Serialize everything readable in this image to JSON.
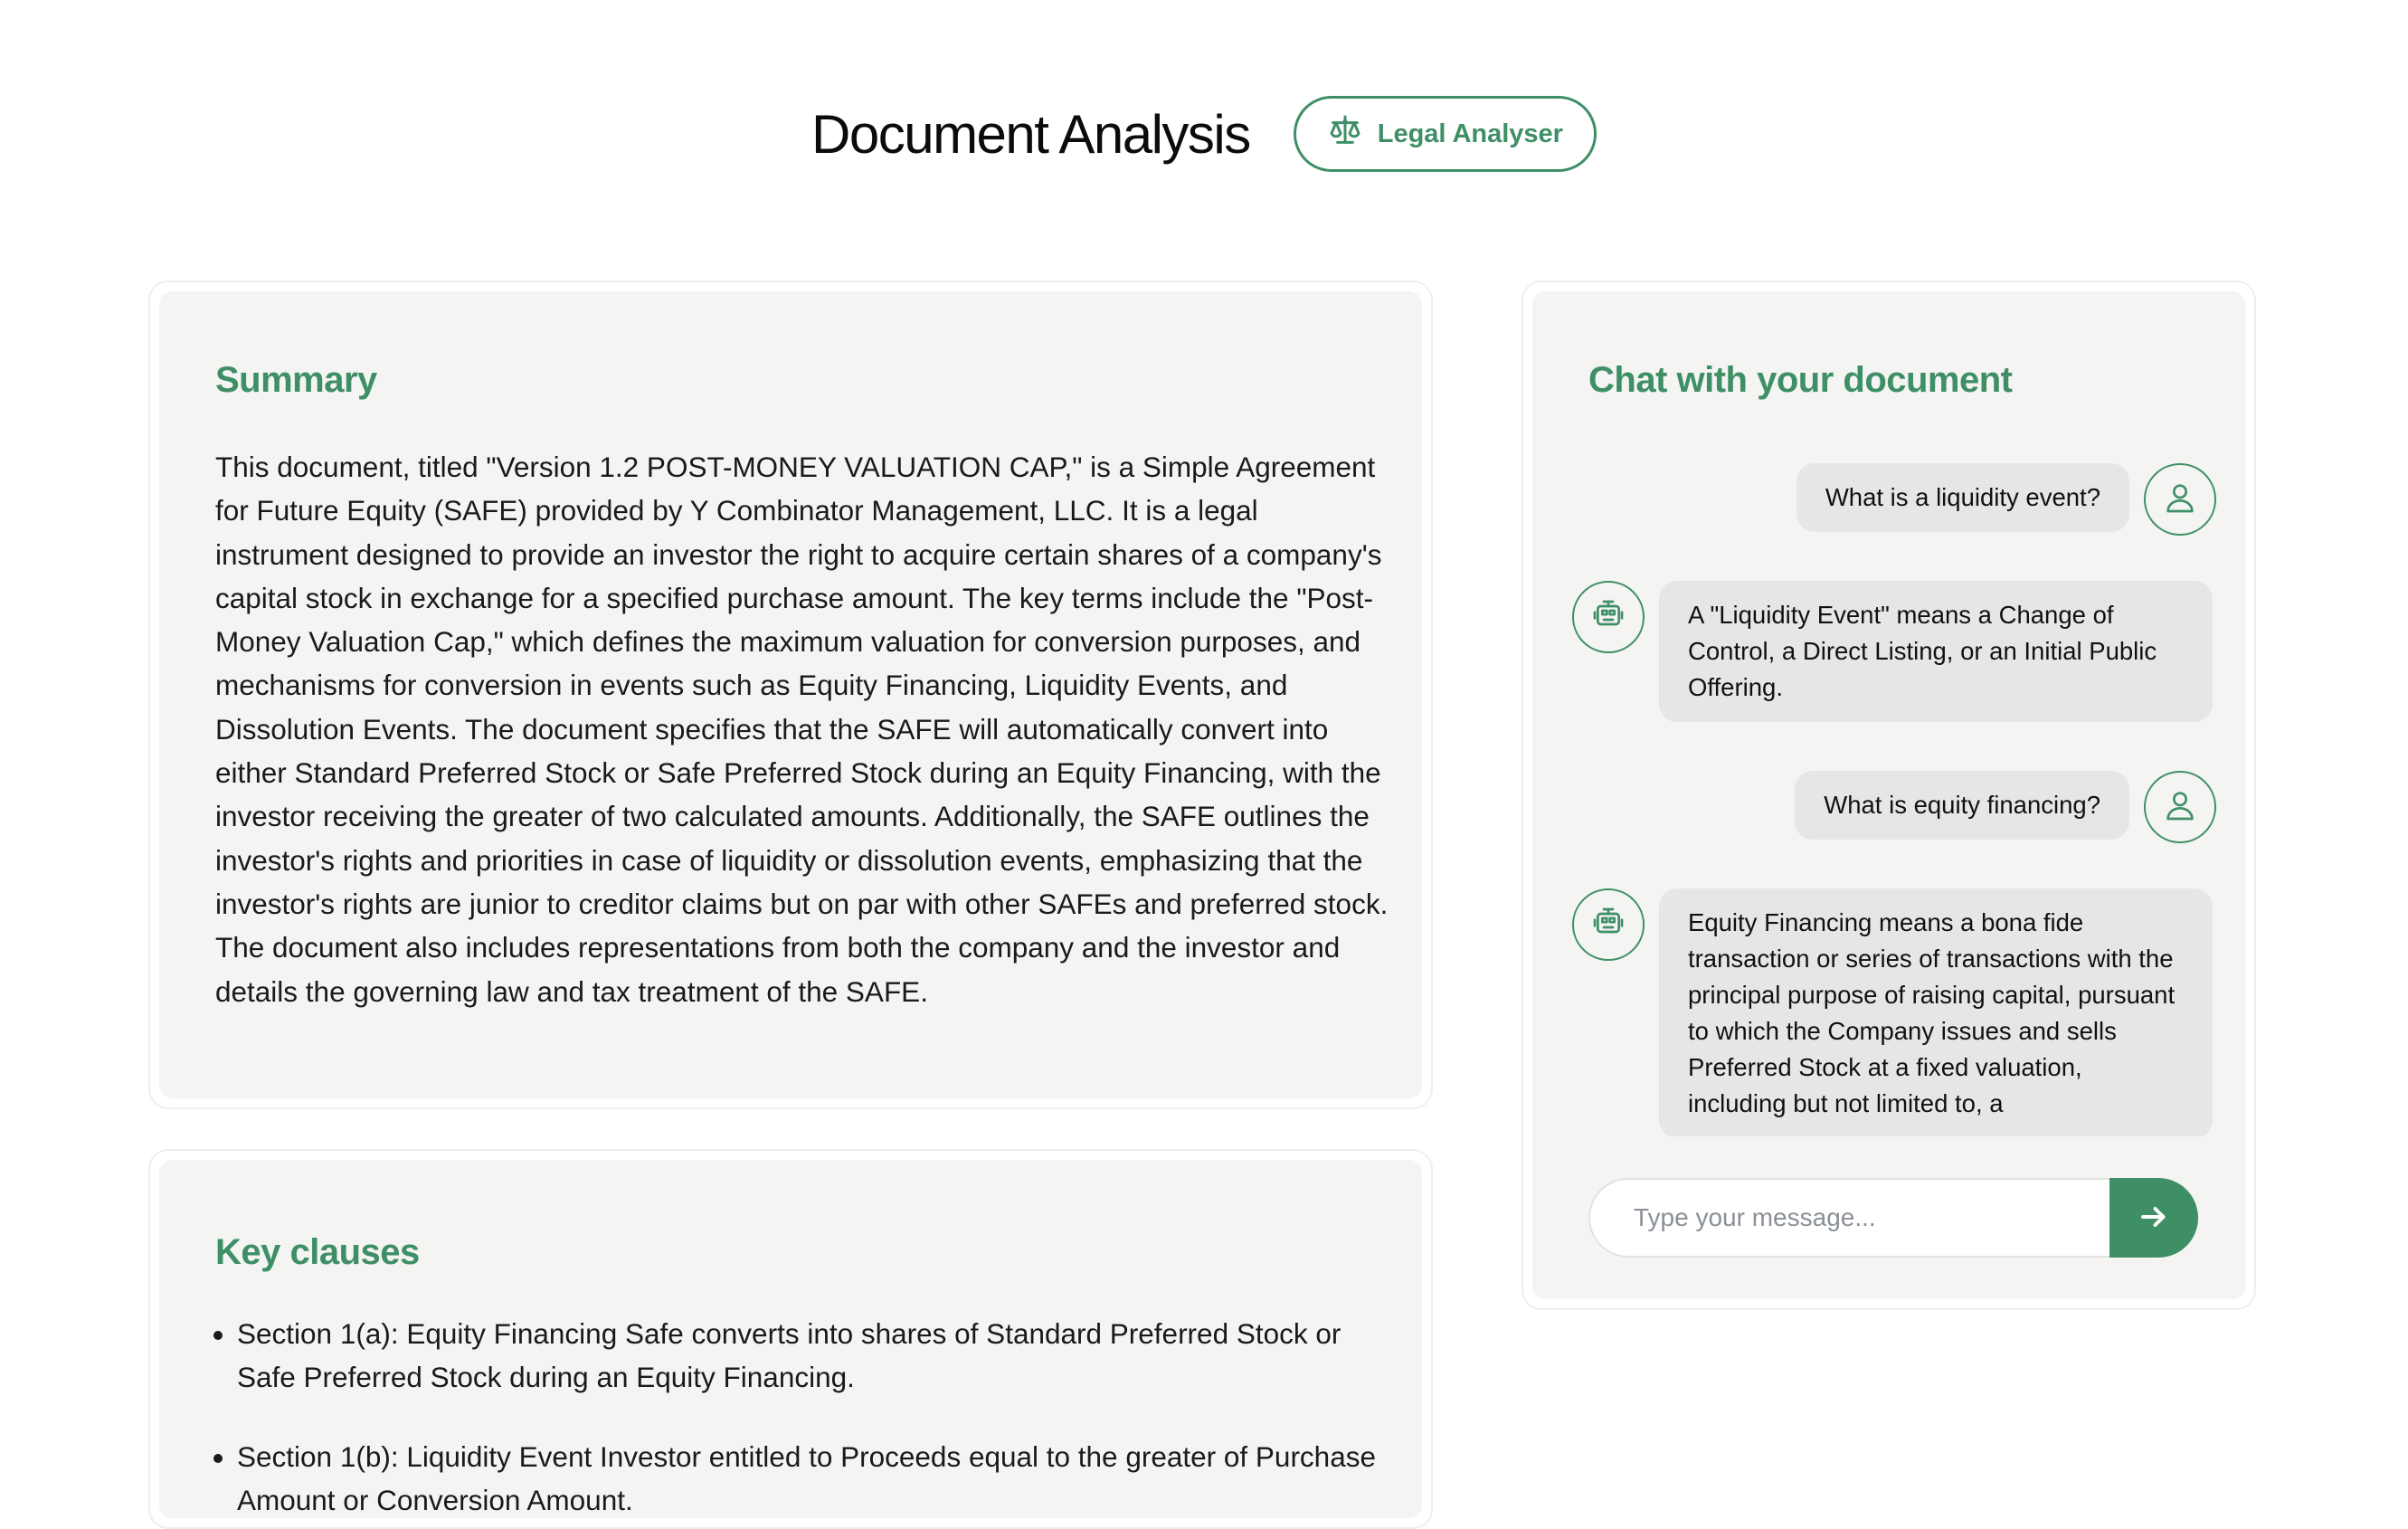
{
  "header": {
    "title": "Document Analysis",
    "badge_label": "Legal Analyser",
    "badge_icon": "scale-icon"
  },
  "summary": {
    "heading": "Summary",
    "text": "This document, titled \"Version 1.2 POST-MONEY VALUATION CAP,\" is a Simple Agreement for Future Equity (SAFE) provided by Y Combinator Management, LLC. It is a legal instrument designed to provide an investor the right to acquire certain shares of a company's capital stock in exchange for a specified purchase amount. The key terms include the \"Post-Money Valuation Cap,\" which defines the maximum valuation for conversion purposes, and mechanisms for conversion in events such as Equity Financing, Liquidity Events, and Dissolution Events. The document specifies that the SAFE will automatically convert into either Standard Preferred Stock or Safe Preferred Stock during an Equity Financing, with the investor receiving the greater of two calculated amounts. Additionally, the SAFE outlines the investor's rights and priorities in case of liquidity or dissolution events, emphasizing that the investor's rights are junior to creditor claims but on par with other SAFEs and preferred stock. The document also includes representations from both the company and the investor and details the governing law and tax treatment of the SAFE."
  },
  "key_clauses": {
    "heading": "Key clauses",
    "items": [
      "Section 1(a): Equity Financing Safe converts into shares of Standard Preferred Stock or Safe Preferred Stock during an Equity Financing.",
      "Section 1(b): Liquidity Event Investor entitled to Proceeds equal to the greater of Purchase Amount or Conversion Amount."
    ]
  },
  "chat": {
    "heading": "Chat with your document",
    "messages": [
      {
        "role": "user",
        "text": "What is a liquidity event?",
        "icon": "user-icon"
      },
      {
        "role": "assistant",
        "text": "A \"Liquidity Event\" means a Change of Control, a Direct Listing, or an Initial Public Offering.",
        "icon": "robot-icon"
      },
      {
        "role": "user",
        "text": "What is equity financing?",
        "icon": "user-icon"
      },
      {
        "role": "assistant",
        "text": "Equity Financing means a bona fide transaction or series of transactions with the principal purpose of raising capital, pursuant to which the Company issues and sells Preferred Stock at a fixed valuation, including but not limited to, a",
        "icon": "robot-icon"
      }
    ],
    "input_placeholder": "Type your message...",
    "input_value": "",
    "send_icon": "arrow-right-icon"
  },
  "colors": {
    "accent": "#3f8f66",
    "card_bg": "#f4f4f2",
    "bubble_bg": "#e6e6e4"
  }
}
